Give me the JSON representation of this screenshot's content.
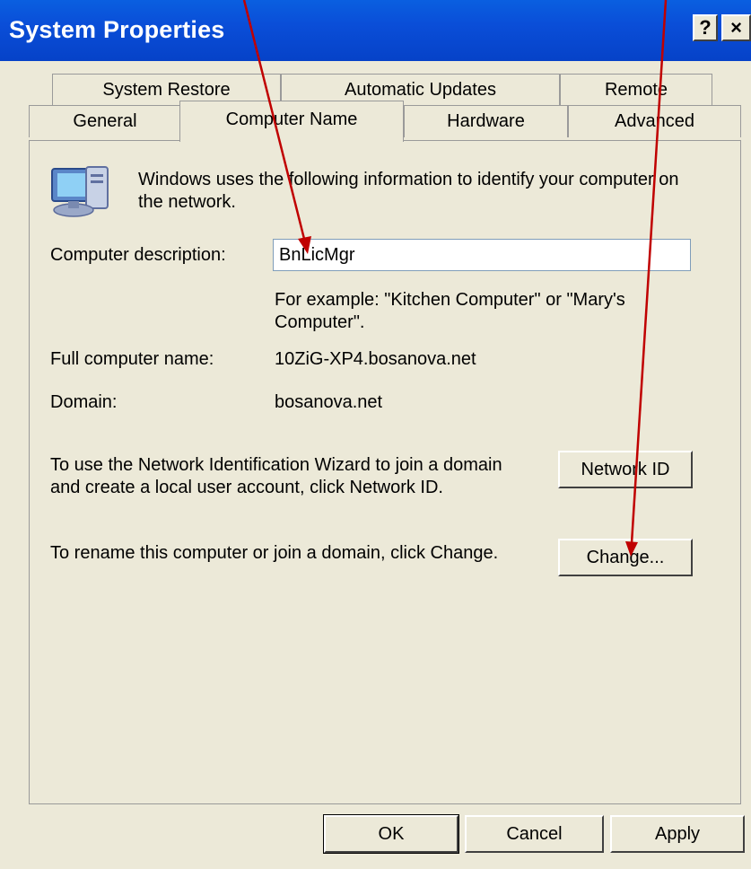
{
  "window": {
    "title": "System Properties"
  },
  "title_buttons": {
    "help": "?",
    "close": "×"
  },
  "tabs": {
    "row1": [
      "System Restore",
      "Automatic Updates",
      "Remote"
    ],
    "row2": [
      "General",
      "Computer Name",
      "Hardware",
      "Advanced"
    ],
    "active": "Computer Name"
  },
  "panel": {
    "intro": "Windows uses the following information to identify your computer on the network.",
    "desc_label": "Computer description:",
    "desc_value": "BnLicMgr",
    "example": "For example: \"Kitchen Computer\" or \"Mary's Computer\".",
    "full_name_label": "Full computer name:",
    "full_name_value": "10ZiG-XP4.bosanova.net",
    "domain_label": "Domain:",
    "domain_value": "bosanova.net",
    "netid_text": "To use the Network Identification Wizard to join a domain and create a local user account, click Network ID.",
    "netid_button": "Network ID",
    "rename_text": "To rename this computer or join a domain, click Change.",
    "change_button": "Change..."
  },
  "buttons": {
    "ok": "OK",
    "cancel": "Cancel",
    "apply": "Apply"
  },
  "annotation_color": "#c00000"
}
